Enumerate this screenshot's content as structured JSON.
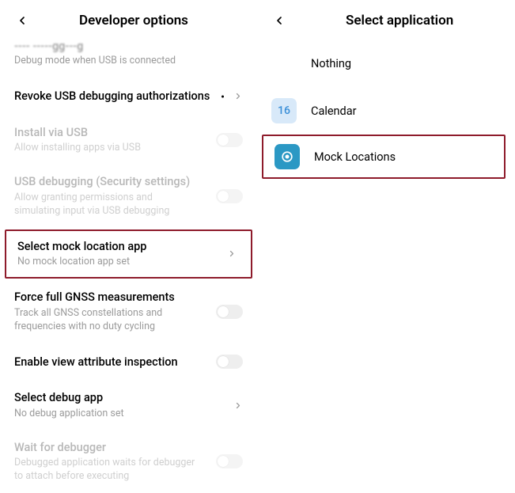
{
  "left": {
    "title": "Developer options",
    "items": {
      "usb_debug": {
        "title": "USB debugging",
        "sub": "Debug mode when USB is connected"
      },
      "revoke": {
        "title": "Revoke USB debugging authorizations"
      },
      "install_usb": {
        "title": "Install via USB",
        "sub": "Allow installing apps via USB"
      },
      "usb_sec": {
        "title": "USB debugging (Security settings)",
        "sub": "Allow granting permissions and simulating input via USB debugging"
      },
      "mock": {
        "title": "Select mock location app",
        "sub": "No mock location app set"
      },
      "gnss": {
        "title": "Force full GNSS measurements",
        "sub": "Track all GNSS constellations and frequencies with no duty cycling"
      },
      "attr": {
        "title": "Enable view attribute inspection"
      },
      "debug_app": {
        "title": "Select debug app",
        "sub": "No debug application set"
      },
      "wait": {
        "title": "Wait for debugger",
        "sub": "Debugged application waits for debugger to attach before executing"
      }
    }
  },
  "right": {
    "title": "Select application",
    "apps": {
      "nothing": "Nothing",
      "calendar": "Calendar",
      "calendar_day": "16",
      "mock": "Mock Locations"
    }
  }
}
